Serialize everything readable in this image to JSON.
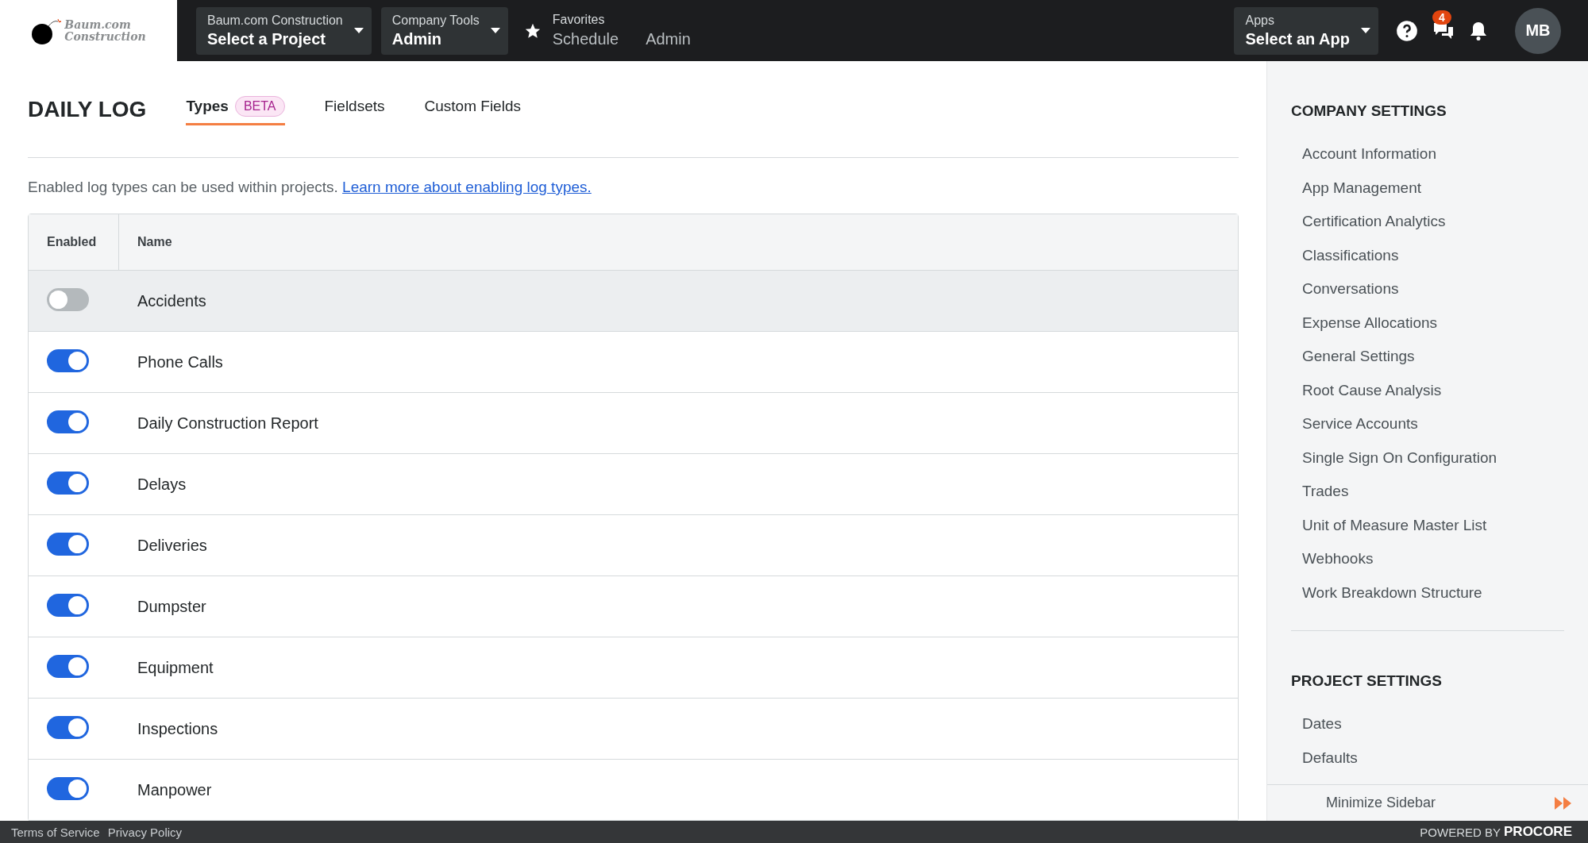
{
  "top_bar": {
    "logo": {
      "line_1": "Baum.com",
      "line_2": "Construction"
    },
    "project_picker": {
      "label": "Baum.com Construction",
      "value": "Select a Project"
    },
    "tool_picker": {
      "label": "Company Tools",
      "value": "Admin"
    },
    "favorites": {
      "label": "Favorites",
      "links": [
        "Schedule",
        "Admin"
      ]
    },
    "app_picker": {
      "label": "Apps",
      "value": "Select an App"
    },
    "messages_badge": "4",
    "avatar": "MB"
  },
  "page": {
    "title": "DAILY LOG",
    "tabs": [
      {
        "label": "Types",
        "badge": "BETA",
        "selected": true
      },
      {
        "label": "Fieldsets",
        "selected": false
      },
      {
        "label": "Custom Fields",
        "selected": false
      }
    ],
    "intro": "Enabled log types can be used within projects.",
    "intro_link": "Learn more about enabling log types.",
    "table": {
      "columns": [
        "Enabled",
        "Name"
      ],
      "rows": [
        {
          "name": "Accidents",
          "enabled": false,
          "highlighted": true
        },
        {
          "name": "Phone Calls",
          "enabled": true,
          "highlighted": false
        },
        {
          "name": "Daily Construction Report",
          "enabled": true,
          "highlighted": false
        },
        {
          "name": "Delays",
          "enabled": true,
          "highlighted": false
        },
        {
          "name": "Deliveries",
          "enabled": true,
          "highlighted": false
        },
        {
          "name": "Dumpster",
          "enabled": true,
          "highlighted": false
        },
        {
          "name": "Equipment",
          "enabled": true,
          "highlighted": false
        },
        {
          "name": "Inspections",
          "enabled": true,
          "highlighted": false
        },
        {
          "name": "Manpower",
          "enabled": true,
          "highlighted": false
        }
      ]
    }
  },
  "sidebar": {
    "sections": [
      {
        "title": "COMPANY SETTINGS",
        "items": [
          "Account Information",
          "App Management",
          "Certification Analytics",
          "Classifications",
          "Conversations",
          "Expense Allocations",
          "General Settings",
          "Root Cause Analysis",
          "Service Accounts",
          "Single Sign On Configuration",
          "Trades",
          "Unit of Measure Master List",
          "Webhooks",
          "Work Breakdown Structure"
        ]
      },
      {
        "title": "PROJECT SETTINGS",
        "items": [
          "Dates",
          "Defaults"
        ]
      }
    ],
    "minimize": "Minimize Sidebar"
  },
  "footer": {
    "links": [
      "Terms of Service",
      "Privacy Policy"
    ],
    "powered_by": "POWERED BY",
    "brand": "PROCORE"
  }
}
